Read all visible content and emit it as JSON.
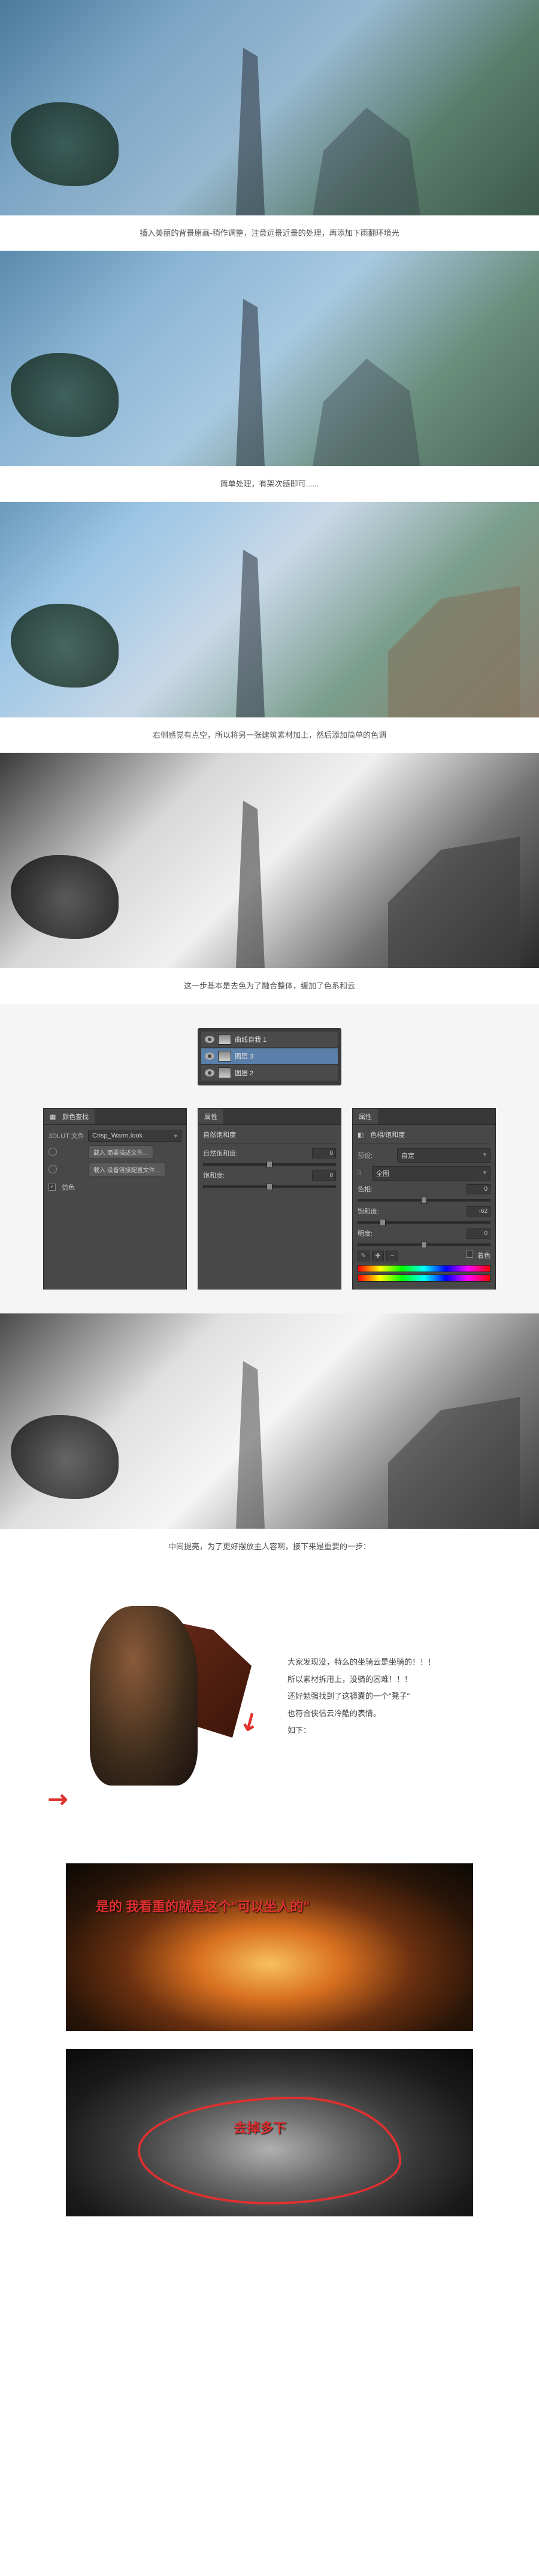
{
  "captions": {
    "c1": "插入美丽的背景原画-稍作调整，注意远景近景的处理，再添加下雨翻环境光",
    "c2": "简单处理，有架次感即可......",
    "c3": "右侧感觉有点空，所以将另一张建筑素材加上，然后添加简单的色调",
    "c4": "这一步基本是去色为了融合整体，缓加了色系和云",
    "c5": "中间提亮，为了更好摆放主人容啊，接下来是重要的一步："
  },
  "layers_panel": {
    "items": [
      {
        "name": "曲线自我 1",
        "selected": false
      },
      {
        "name": "图层 3",
        "selected": true
      },
      {
        "name": "图层 2",
        "selected": false
      }
    ]
  },
  "panel_lut": {
    "tab": "颜色查找",
    "file_label": "3DLUT 文件",
    "file_value": "Crisp_Warm.look",
    "btn_load1": "载入 简要描述文件...",
    "btn_load2": "载入 设备链接配置文件...",
    "checkbox_dither": "仿色"
  },
  "panel_hue_left": {
    "tab": "属性",
    "sub": "自然饱和度",
    "row1_label": "自然饱和度:",
    "row1_value": "0",
    "row2_label": "饱和度:",
    "row2_value": "0"
  },
  "panel_hue_right": {
    "tab": "属性",
    "sub": "色相/饱和度",
    "preset_label": "预设:",
    "preset_value": "自定",
    "scope_value": "全图",
    "hue_label": "色相:",
    "hue_value": "0",
    "sat_label": "饱和度:",
    "sat_value": "-62",
    "light_label": "明度:",
    "light_value": "0",
    "colorize_label": "着色"
  },
  "character": {
    "line1": "大家发现没，特么的坐骑云是坐骑的！！！",
    "line2": "所以素材拆用上，没骑的困难！！！",
    "line3": "还好勉强找到了这褥囊的一个\"凳子\"",
    "line4": "也符合侠侣云冷酷的表情。",
    "line5": "如下："
  },
  "cave_overlay": {
    "text1": "是的 我看重的就是这个\"可以坐人的\"",
    "text2": "去掉多下"
  }
}
